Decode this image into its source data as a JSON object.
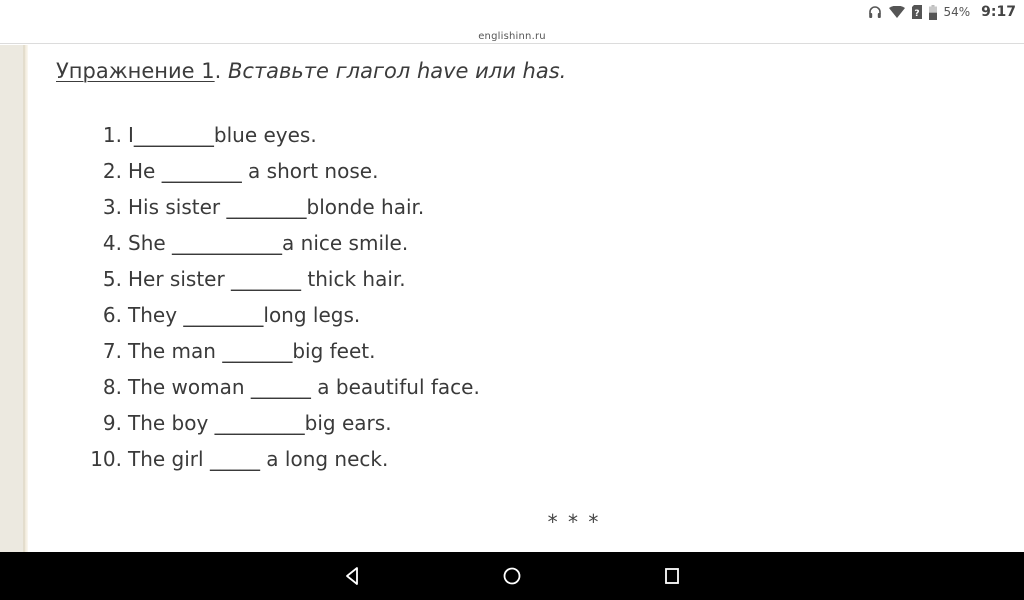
{
  "status_bar": {
    "icons": [
      "headphones-icon",
      "wifi-icon",
      "sim-unknown-icon",
      "battery-icon"
    ],
    "battery_percent": "54%",
    "battery_level": 0.54,
    "time": "9:17"
  },
  "url_bar": {
    "domain": "englishinn.ru"
  },
  "exercise": {
    "label": "Упражнение 1",
    "separator": ". ",
    "instruction": "Вставьте глагол have или has.",
    "sentences": [
      {
        "num": "1.",
        "text": "I________blue eyes."
      },
      {
        "num": "2.",
        "text": "He ________ a short nose."
      },
      {
        "num": "3.",
        "text": "His sister ________blonde hair."
      },
      {
        "num": "4.",
        "text": "She ___________a nice smile."
      },
      {
        "num": "5.",
        "text": "Her sister _______ thick hair."
      },
      {
        "num": "6.",
        "text": "They ________long legs."
      },
      {
        "num": "7.",
        "text": "The man _______big feet."
      },
      {
        "num": "8.",
        "text": "The woman ______ a beautiful face."
      },
      {
        "num": "9.",
        "text": "The boy _________big ears."
      },
      {
        "num": "10.",
        "text": "The girl _____ a long neck."
      }
    ]
  },
  "section_separator": "* * *",
  "nav_bar": {
    "buttons": [
      "back",
      "home",
      "recents"
    ]
  },
  "colors": {
    "text": "#3a3a3a",
    "side_strip": "#ece9e0",
    "nav_bar": "#000000"
  }
}
